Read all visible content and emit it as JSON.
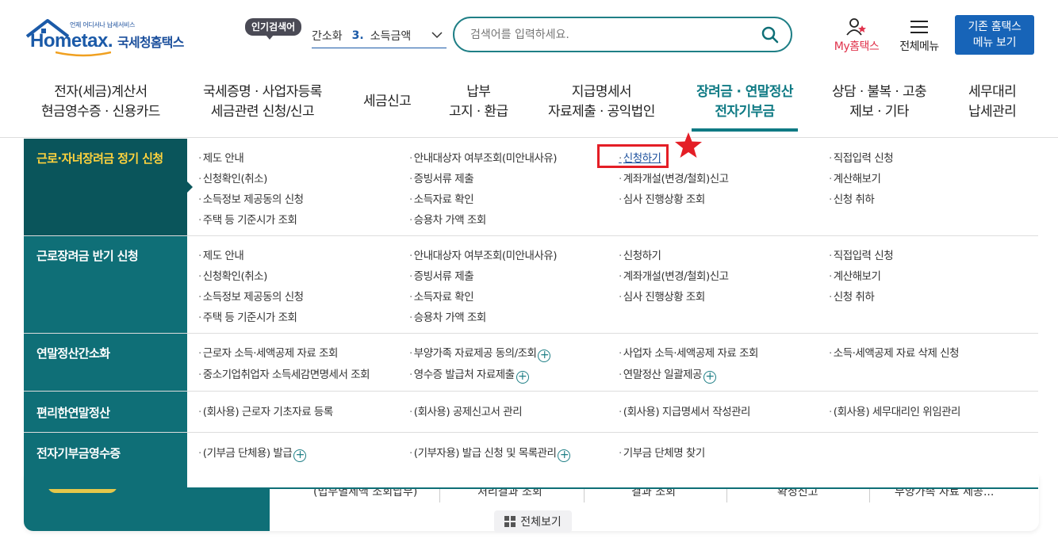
{
  "header": {
    "logo_tagline": "언제 어디서나 납세서비스",
    "logo_brand": "Hometax.",
    "logo_brand_ko": "국세청홈택스",
    "popular_badge": "인기검색어",
    "popular_prev": "간소화",
    "popular_current_num": "3.",
    "popular_current": "소득금액",
    "search_placeholder": "검색어를 입력하세요.",
    "my_hometax": "My홈택스",
    "all_menu": "전체메뉴",
    "old_menu_line1": "기존 홈택스",
    "old_menu_line2": "메뉴 보기"
  },
  "gnb": [
    {
      "l1": "전자(세금)계산서",
      "l2": "현금영수증 · 신용카드"
    },
    {
      "l1": "국세증명 · 사업자등록",
      "l2": "세금관련 신청/신고"
    },
    {
      "l1": "세금신고",
      "l2": ""
    },
    {
      "l1": "납부",
      "l2": "고지 · 환급"
    },
    {
      "l1": "지급명세서",
      "l2": "자료제출 · 공익법인"
    },
    {
      "l1": "장려금 · 연말정산",
      "l2": "전자기부금"
    },
    {
      "l1": "상담 · 불복 · 고충",
      "l2": "제보 · 기타"
    },
    {
      "l1": "세무대리",
      "l2": "납세관리"
    }
  ],
  "dropdown": {
    "sections": [
      {
        "title": "근로·자녀장려금 정기 신청",
        "links": [
          "제도 안내",
          "안내대상자 여부조회(미안내사유)",
          "신청하기",
          "직접입력 신청",
          "신청확인(취소)",
          "증빙서류 제출",
          "계좌개설(변경/철회)신고",
          "계산해보기",
          "소득정보 제공동의 신청",
          "소득자료 확인",
          "심사 진행상황 조회",
          "신청 취하",
          "주택 등 기준시가 조회",
          "승용차 가액 조회"
        ]
      },
      {
        "title": "근로장려금 반기 신청",
        "links": [
          "제도 안내",
          "안내대상자 여부조회(미안내사유)",
          "신청하기",
          "직접입력 신청",
          "신청확인(취소)",
          "증빙서류 제출",
          "계좌개설(변경/철회)신고",
          "계산해보기",
          "소득정보 제공동의 신청",
          "소득자료 확인",
          "심사 진행상황 조회",
          "신청 취하",
          "주택 등 기준시가 조회",
          "승용차 가액 조회"
        ]
      },
      {
        "title": "연말정산간소화",
        "links": [
          "근로자 소득·세액공제 자료 조회",
          "부양가족 자료제공 동의/조회",
          "사업자 소득·세액공제 자료 조회",
          "소득·세액공제 자료 삭제 신청",
          "중소기업취업자 소득세감면명세서 조회",
          "영수증 발급처 자료제출",
          "연말정산 일괄제공"
        ]
      },
      {
        "title": "편리한연말정산",
        "links": [
          "(회사용) 근로자 기초자료 등록",
          "(회사용) 공제신고서 관리",
          "(회사용) 지급명세서 작성관리",
          "(회사용) 세무대리인 위임관리"
        ]
      },
      {
        "title": "전자기부금영수증",
        "links": [
          "(기부금 단체용) 발급",
          "(기부자용) 발급 신청 및 목록관리",
          "기부금 단체명 찾기"
        ]
      }
    ]
  },
  "background": {
    "cells": [
      "(법무별세액 조회납부)",
      "처리결과 조회",
      "결과 조회",
      "확정신고",
      "부양가족 자료 제공..."
    ],
    "view_all": "전체보기"
  }
}
